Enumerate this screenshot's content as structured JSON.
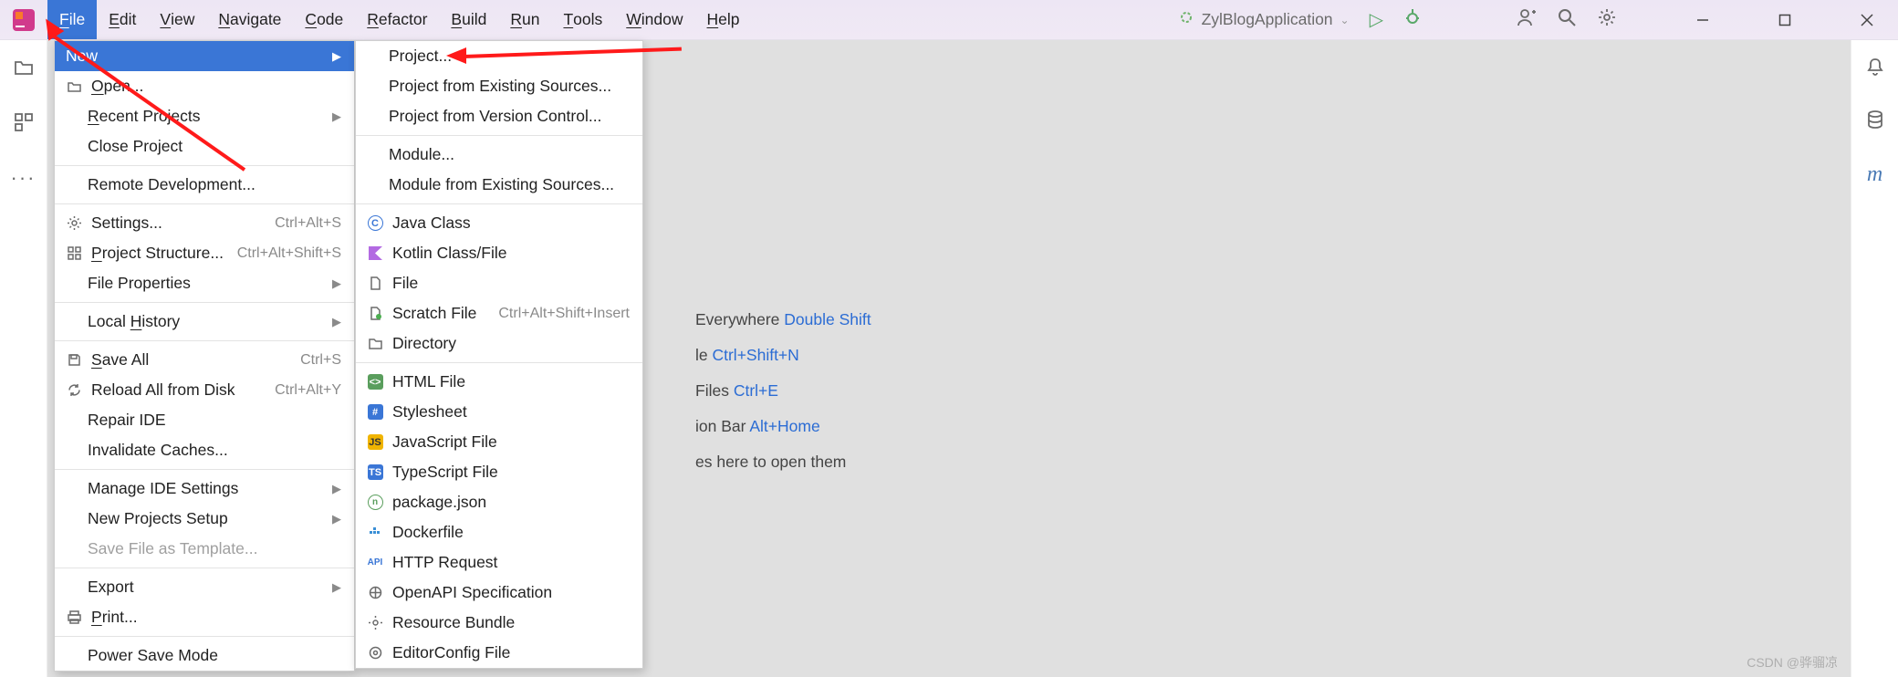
{
  "menubar": {
    "items": [
      "File",
      "Edit",
      "View",
      "Navigate",
      "Code",
      "Refactor",
      "Build",
      "Run",
      "Tools",
      "Window",
      "Help"
    ],
    "active_index": 0
  },
  "run_config": {
    "name": "ZylBlogApplication"
  },
  "file_menu": [
    {
      "label": "New",
      "icon": "",
      "selected": true,
      "submenu": true
    },
    {
      "label": "Open...",
      "icon": "folder-open",
      "mn": 0
    },
    {
      "label": "Recent Projects",
      "submenu": true,
      "mn": 0,
      "indent": true
    },
    {
      "label": "Close Project",
      "indent": true
    },
    {
      "sep": true
    },
    {
      "label": "Remote Development...",
      "indent": true
    },
    {
      "sep": true
    },
    {
      "label": "Settings...",
      "icon": "gear",
      "shortcut": "Ctrl+Alt+S"
    },
    {
      "label": "Project Structure...",
      "icon": "structure",
      "shortcut": "Ctrl+Alt+Shift+S",
      "mn": 0
    },
    {
      "label": "File Properties",
      "submenu": true,
      "indent": true
    },
    {
      "sep": true
    },
    {
      "label": "Local History",
      "submenu": true,
      "mn": 6,
      "indent": true
    },
    {
      "sep": true
    },
    {
      "label": "Save All",
      "icon": "save",
      "shortcut": "Ctrl+S",
      "mn": 0
    },
    {
      "label": "Reload All from Disk",
      "icon": "reload",
      "shortcut": "Ctrl+Alt+Y"
    },
    {
      "label": "Repair IDE",
      "indent": true
    },
    {
      "label": "Invalidate Caches...",
      "indent": true
    },
    {
      "sep": true
    },
    {
      "label": "Manage IDE Settings",
      "submenu": true,
      "indent": true
    },
    {
      "label": "New Projects Setup",
      "submenu": true,
      "indent": true
    },
    {
      "label": "Save File as Template...",
      "disabled": true,
      "indent": true
    },
    {
      "sep": true
    },
    {
      "label": "Export",
      "submenu": true,
      "indent": true
    },
    {
      "label": "Print...",
      "icon": "print",
      "mn": 0
    },
    {
      "sep": true
    },
    {
      "label": "Power Save Mode",
      "indent": true
    }
  ],
  "new_menu": [
    {
      "label": "Project...",
      "indent": true
    },
    {
      "label": "Project from Existing Sources...",
      "indent": true
    },
    {
      "label": "Project from Version Control...",
      "indent": true
    },
    {
      "sep": true
    },
    {
      "label": "Module...",
      "indent": true
    },
    {
      "label": "Module from Existing Sources...",
      "indent": true
    },
    {
      "sep": true
    },
    {
      "label": "Java Class",
      "icon": "java-c"
    },
    {
      "label": "Kotlin Class/File",
      "icon": "kotlin"
    },
    {
      "label": "File",
      "icon": "file"
    },
    {
      "label": "Scratch File",
      "icon": "scratch",
      "shortcut": "Ctrl+Alt+Shift+Insert"
    },
    {
      "label": "Directory",
      "icon": "folder"
    },
    {
      "sep": true
    },
    {
      "label": "HTML File",
      "icon": "html"
    },
    {
      "label": "Stylesheet",
      "icon": "css"
    },
    {
      "label": "JavaScript File",
      "icon": "js"
    },
    {
      "label": "TypeScript File",
      "icon": "ts"
    },
    {
      "label": "package.json",
      "icon": "npm"
    },
    {
      "label": "Dockerfile",
      "icon": "docker"
    },
    {
      "label": "HTTP Request",
      "icon": "http"
    },
    {
      "label": "OpenAPI Specification",
      "icon": "openapi"
    },
    {
      "label": "Resource Bundle",
      "icon": "bundle"
    },
    {
      "label": "EditorConfig File",
      "icon": "editorconfig"
    }
  ],
  "hints": [
    {
      "pre": "Everywhere ",
      "key": "Double Shift"
    },
    {
      "pre": "le ",
      "key": "Ctrl+Shift+N"
    },
    {
      "pre": "Files ",
      "key": "Ctrl+E"
    },
    {
      "pre": "ion Bar ",
      "key": "Alt+Home"
    },
    {
      "pre": "es here to open them",
      "key": ""
    }
  ],
  "watermark": "CSDN @骅骝凉"
}
